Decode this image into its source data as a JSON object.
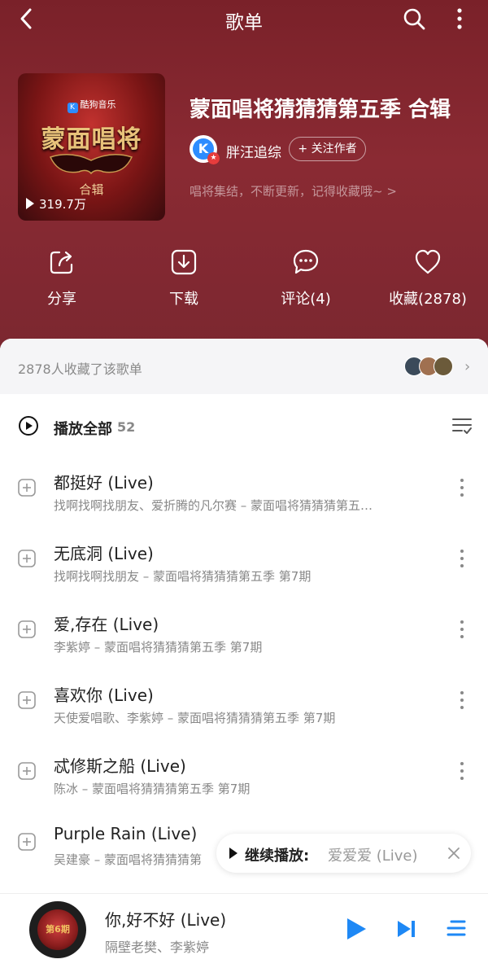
{
  "topbar": {
    "title": "歌单"
  },
  "cover": {
    "brand": "酷狗音乐",
    "logo_text": "蒙面唱将",
    "subtitle": "合辑",
    "play_count": "319.7万"
  },
  "playlist": {
    "title": "蒙面唱将猜猜猜第五季 合辑",
    "author": "胖汪追综",
    "follow_label": "+ 关注作者",
    "description": "唱将集结，不断更新，记得收藏哦~ >"
  },
  "actions": [
    {
      "label": "分享",
      "icon": "share-icon"
    },
    {
      "label": "下载",
      "icon": "download-icon"
    },
    {
      "label": "评论(4)",
      "icon": "comment-icon"
    },
    {
      "label": "收藏(2878)",
      "icon": "heart-icon"
    }
  ],
  "favorites": {
    "text": "2878人收藏了该歌单"
  },
  "play_all": {
    "label": "播放全部",
    "count": "52"
  },
  "songs": [
    {
      "name": "都挺好 (Live)",
      "meta": "找啊找啊找朋友、爱折腾的凡尔赛 – 蒙面唱将猜猜猜第五…"
    },
    {
      "name": "无底洞 (Live)",
      "meta": "找啊找啊找朋友 – 蒙面唱将猜猜猜第五季 第7期"
    },
    {
      "name": "爱,存在 (Live)",
      "meta": "李紫婷 – 蒙面唱将猜猜猜第五季 第7期"
    },
    {
      "name": "喜欢你 (Live)",
      "meta": "天使爱唱歌、李紫婷 – 蒙面唱将猜猜猜第五季 第7期"
    },
    {
      "name": "忒修斯之船 (Live)",
      "meta": "陈冰 – 蒙面唱将猜猜猜第五季 第7期"
    },
    {
      "name": "Purple Rain (Live)",
      "meta": "吴建豪 – 蒙面唱将猜猜猜第"
    }
  ],
  "resume_bar": {
    "label": "继续播放:",
    "song": "爱爱爱 (Live)"
  },
  "player": {
    "title": "你,好不好 (Live)",
    "artist": "隔壁老樊、李紫婷",
    "disc_text": "第6期"
  },
  "colors": {
    "header_bg": "#7a2129",
    "accent_blue": "#2d8cff"
  }
}
